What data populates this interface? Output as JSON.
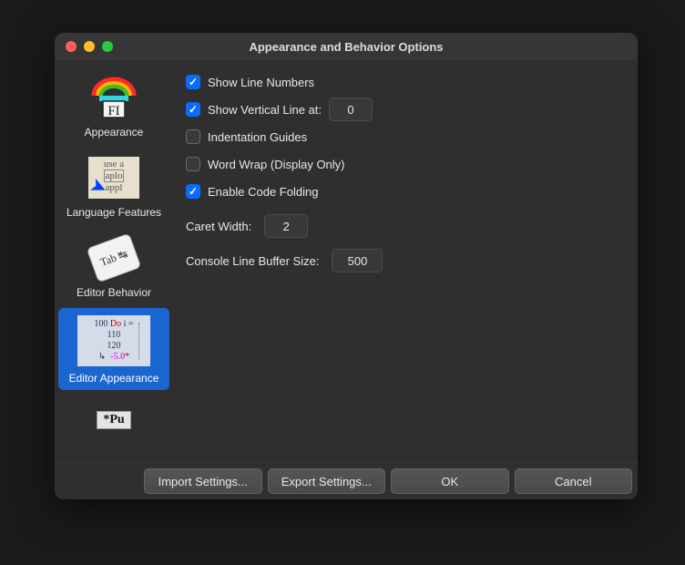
{
  "window": {
    "title": "Appearance and Behavior Options"
  },
  "sidebar": {
    "items": [
      {
        "label": "Appearance"
      },
      {
        "label": "Language Features"
      },
      {
        "label": "Editor Behavior"
      },
      {
        "label": "Editor Appearance"
      }
    ]
  },
  "options": {
    "show_line_numbers_label": "Show Line Numbers",
    "show_vertical_line_label": "Show Vertical Line at:",
    "show_vertical_line_value": "0",
    "indentation_guides_label": "Indentation Guides",
    "word_wrap_label": "Word Wrap (Display Only)",
    "enable_code_folding_label": "Enable Code Folding",
    "caret_width_label": "Caret Width:",
    "caret_width_value": "2",
    "console_buffer_label": "Console Line Buffer Size:",
    "console_buffer_value": "500"
  },
  "buttons": {
    "import": "Import Settings...",
    "export": "Export Settings...",
    "ok": "OK",
    "cancel": "Cancel"
  },
  "thumb_text": {
    "appearance_fi": "FI",
    "lang_line1": "use a",
    "lang_line2": "aplo",
    "lang_line3": "appl",
    "behavior": "Tab ↹",
    "ea_100": "100",
    "ea_110": "110",
    "ea_120": "120",
    "ea_do": "Do",
    "ea_i_eq": "i =",
    "ea_neg5": "-5.0",
    "ea_star": "*",
    "partial": "*Pu"
  }
}
